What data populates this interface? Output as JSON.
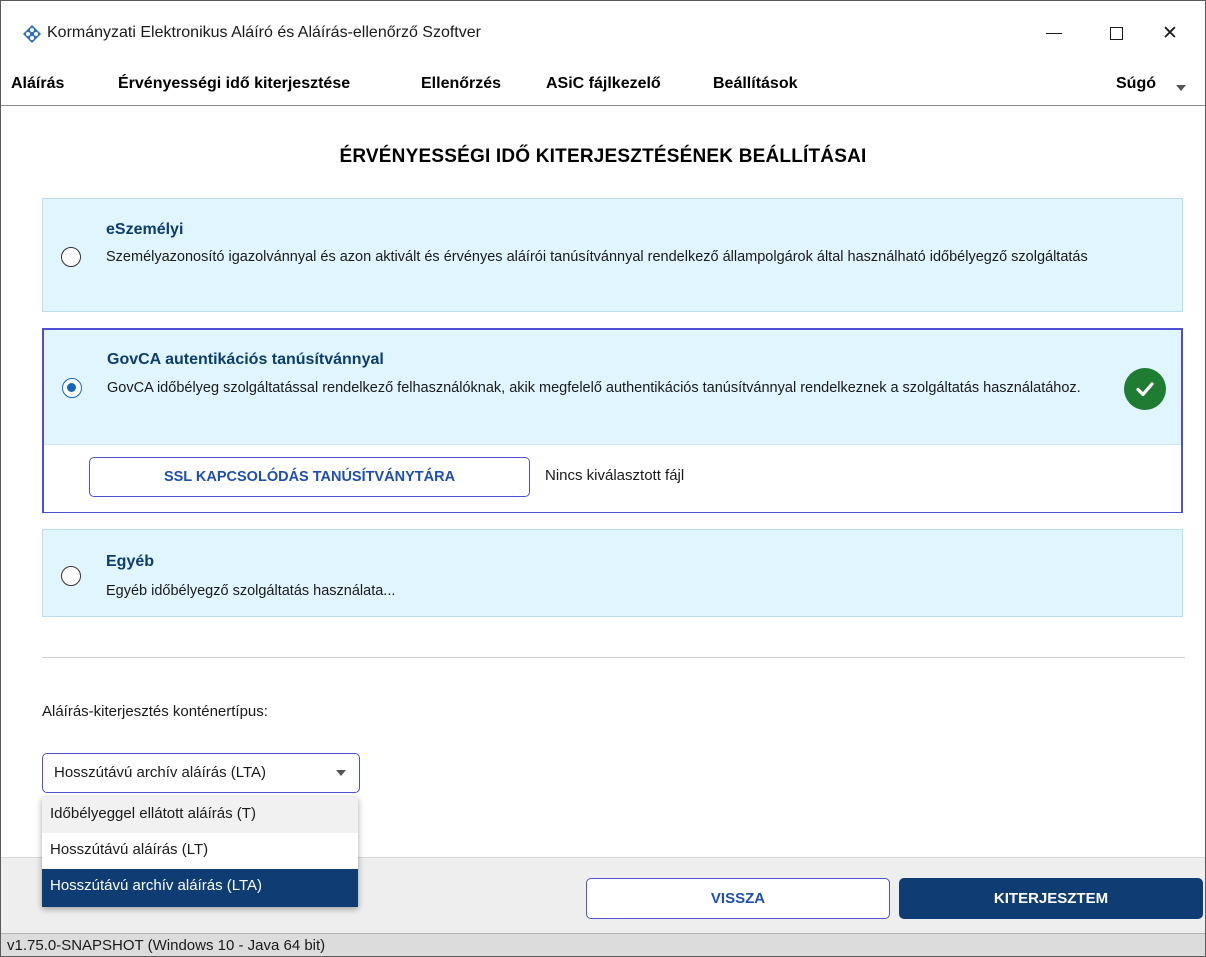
{
  "window": {
    "title": "Kormányzati Elektronikus Aláíró és Aláírás-ellenőrző Szoftver",
    "controls": {
      "minimize": "minimize-icon",
      "maximize": "maximize-icon",
      "close": "close-icon"
    },
    "close_glyph": "✕"
  },
  "menu": {
    "items": [
      "Aláírás",
      "Érvényességi idő kiterjesztése",
      "Ellenőrzés",
      "ASiC fájlkezelő",
      "Beállítások"
    ],
    "help": "Súgó"
  },
  "page": {
    "title": "ÉRVÉNYESSÉGI IDŐ KITERJESZTÉSÉNEK BEÁLLÍTÁSAI"
  },
  "options": [
    {
      "title": "eSzemélyi",
      "description": "Személyazonosító igazolvánnyal és azon aktivált és érvényes aláírói tanúsítvánnyal rendelkező állampolgárok által használható időbélyegző szolgáltatás",
      "selected": false
    },
    {
      "title": "GovCA autentikációs tanúsítvánnyal",
      "description": "GovCA időbélyeg szolgáltatással rendelkező felhasználóknak, akik megfelelő authentikációs tanúsítvánnyal rendelkeznek a szolgáltatás használatához.",
      "selected": true,
      "ssl_button": "SSL KAPCSOLÓDÁS TANÚSÍTVÁNYTÁRA",
      "ssl_status": "Nincs kiválasztott fájl"
    },
    {
      "title": "Egyéb",
      "description": "Egyéb időbélyegző szolgáltatás használata...",
      "selected": false
    }
  ],
  "container": {
    "label": "Aláírás-kiterjesztés konténertípus:",
    "selected": "Hosszútávú archív aláírás (LTA)",
    "options": [
      "Időbélyeggel ellátott aláírás (T)",
      "Hosszútávú aláírás (LT)",
      "Hosszútávú archív aláírás (LTA)"
    ]
  },
  "buttons": {
    "back": "VISSZA",
    "extend": "KITERJESZTEM"
  },
  "status": {
    "text": "v1.75.0-SNAPSHOT (Windows 10 - Java 64 bit)"
  },
  "colors": {
    "accent": "#4f4fd2",
    "primary_dark": "#0f3d73",
    "card_bg": "#e1f5fe",
    "success": "#1e7d32"
  }
}
